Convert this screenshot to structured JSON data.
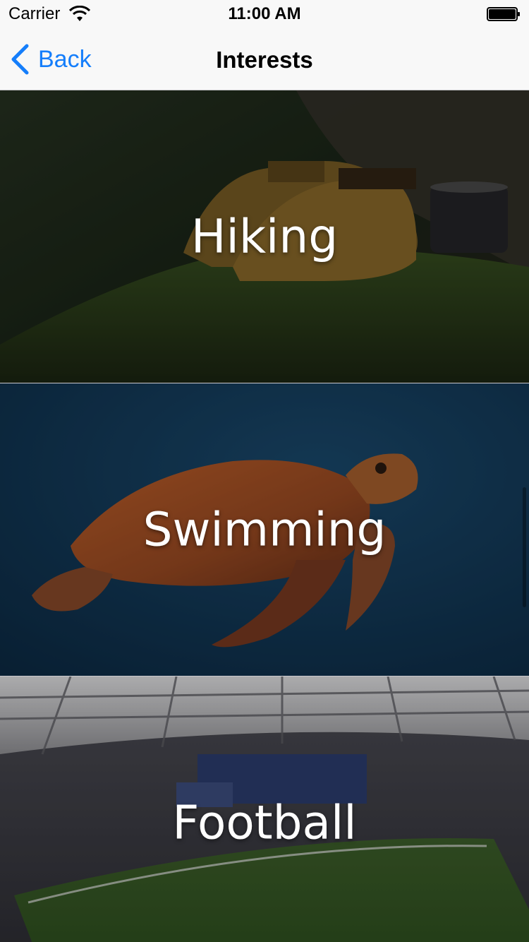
{
  "status_bar": {
    "carrier": "Carrier",
    "time": "11:00 AM",
    "icons": [
      "wifi-icon",
      "battery-icon"
    ]
  },
  "nav": {
    "back_label": "Back",
    "title": "Interests",
    "accent_color": "#157efb"
  },
  "interests": [
    {
      "label": "Hiking",
      "image": "boots-on-mossy-log"
    },
    {
      "label": "Swimming",
      "image": "sea-turtle-underwater"
    },
    {
      "label": "Football",
      "image": "football-stadium"
    }
  ]
}
